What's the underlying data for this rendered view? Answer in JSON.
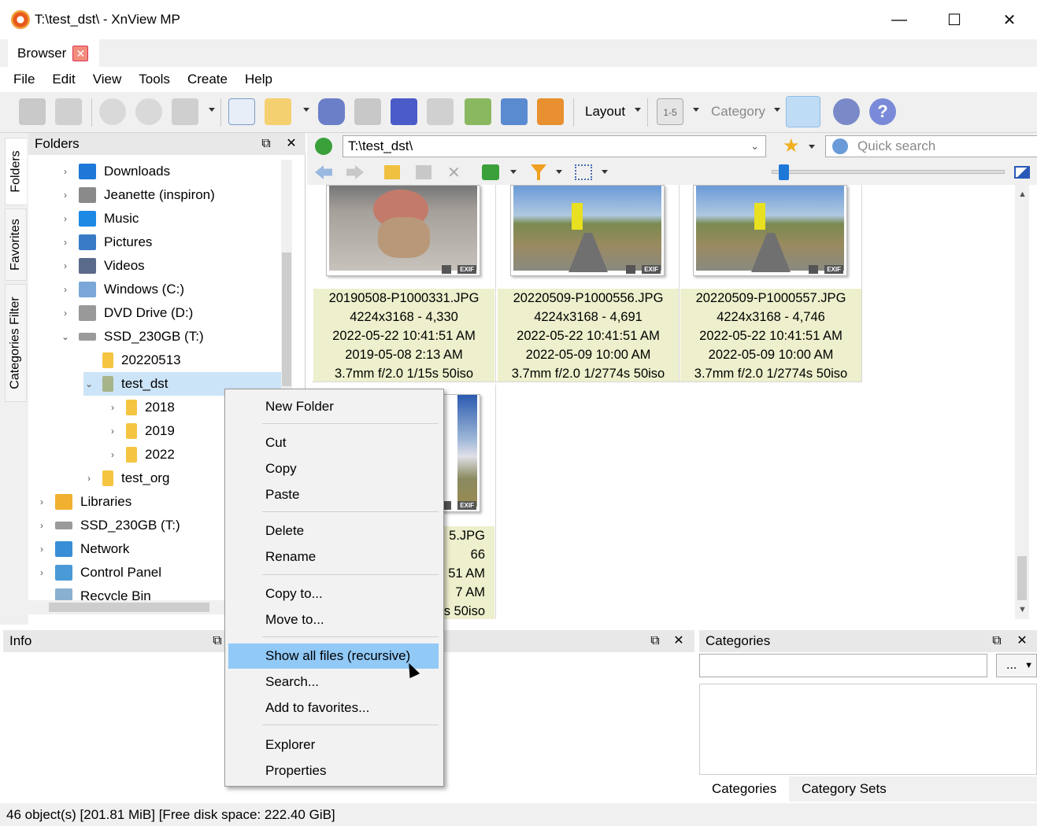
{
  "window": {
    "title": "T:\\test_dst\\ - XnView MP",
    "minimize": "—",
    "maximize": "☐",
    "close": "✕"
  },
  "tabs": [
    {
      "label": "Browser",
      "close": "✕"
    }
  ],
  "menu": [
    "File",
    "Edit",
    "View",
    "Tools",
    "Create",
    "Help"
  ],
  "toolbar": {
    "layout_label": "Layout",
    "category_label": "Category",
    "range_label": "1-5"
  },
  "sidetabs": [
    "Folders",
    "Favorites",
    "Categories Filter"
  ],
  "folders": {
    "title": "Folders",
    "tree": [
      {
        "label": "Downloads",
        "icon": "download-icon",
        "color": "#1e78d8"
      },
      {
        "label": "Jeanette (inspiron)",
        "icon": "phone-icon",
        "color": "#8a8a8a"
      },
      {
        "label": "Music",
        "icon": "music-icon",
        "color": "#1e88e5"
      },
      {
        "label": "Pictures",
        "icon": "pictures-icon",
        "color": "#3a7bc8"
      },
      {
        "label": "Videos",
        "icon": "videos-icon",
        "color": "#5a6a8a"
      },
      {
        "label": "Windows (C:)",
        "icon": "drive-windows-icon",
        "color": "#7aa7d8"
      },
      {
        "label": "DVD Drive (D:)",
        "icon": "dvd-icon",
        "color": "#999999"
      },
      {
        "label": "SSD_230GB (T:)",
        "icon": "drive-icon",
        "color": "#9a9a9a"
      },
      {
        "label": "20220513",
        "icon": "folder-icon",
        "color": "#f5c542"
      },
      {
        "label": "test_dst",
        "icon": "folder-open-icon",
        "color": "#a7b48a"
      },
      {
        "label": "2018",
        "icon": "folder-icon",
        "color": "#f5c542"
      },
      {
        "label": "2019",
        "icon": "folder-icon",
        "color": "#f5c542"
      },
      {
        "label": "2022",
        "icon": "folder-icon",
        "color": "#f5c542"
      },
      {
        "label": "test_org",
        "icon": "folder-icon",
        "color": "#f5c542"
      },
      {
        "label": "Libraries",
        "icon": "libraries-icon",
        "color": "#f0b030"
      },
      {
        "label": "SSD_230GB (T:)",
        "icon": "drive-icon",
        "color": "#9a9a9a"
      },
      {
        "label": "Network",
        "icon": "network-icon",
        "color": "#3a8ed8"
      },
      {
        "label": "Control Panel",
        "icon": "control-panel-icon",
        "color": "#4a9ad8"
      },
      {
        "label": "Recycle Bin",
        "icon": "recycle-bin-icon",
        "color": "#8ab0d0"
      }
    ]
  },
  "path": {
    "value": "T:\\test_dst\\",
    "search_placeholder": "Quick search"
  },
  "thumbnails": [
    {
      "name": "20190508-P1000331.JPG",
      "dims": "4224x3168 - 4,330",
      "modified": "2022-05-22 10:41:51 AM",
      "taken": "2019-05-08 2:13 AM",
      "exif": "3.7mm f/2.0 1/15s 50iso",
      "badge": "EXIF"
    },
    {
      "name": "20220509-P1000556.JPG",
      "dims": "4224x3168 - 4,691",
      "modified": "2022-05-22 10:41:51 AM",
      "taken": "2022-05-09 10:00 AM",
      "exif": "3.7mm f/2.0 1/2774s 50iso",
      "badge": "EXIF"
    },
    {
      "name": "20220509-P1000557.JPG",
      "dims": "4224x3168 - 4,746",
      "modified": "2022-05-22 10:41:51 AM",
      "taken": "2022-05-09 10:00 AM",
      "exif": "3.7mm f/2.0 1/2774s 50iso",
      "badge": "EXIF"
    },
    {
      "name": "5.JPG",
      "dims": "66",
      "modified": "51 AM",
      "taken": "7 AM",
      "exif": "s 50iso",
      "badge": "EXIF"
    }
  ],
  "panes": {
    "info": "Info",
    "categories": "Categories",
    "cat_button": "...",
    "cat_tabs": [
      "Categories",
      "Category Sets"
    ]
  },
  "status": "46 object(s) [201.81 MiB] [Free disk space: 222.40 GiB]",
  "context_menu": [
    {
      "label": "New Folder"
    },
    {
      "label": "Cut"
    },
    {
      "label": "Copy"
    },
    {
      "label": "Paste"
    },
    {
      "label": "Delete"
    },
    {
      "label": "Rename"
    },
    {
      "label": "Copy to..."
    },
    {
      "label": "Move to..."
    },
    {
      "label": "Show all files (recursive)",
      "highlighted": true
    },
    {
      "label": "Search..."
    },
    {
      "label": "Add to favorites..."
    },
    {
      "label": "Explorer"
    },
    {
      "label": "Properties"
    }
  ]
}
